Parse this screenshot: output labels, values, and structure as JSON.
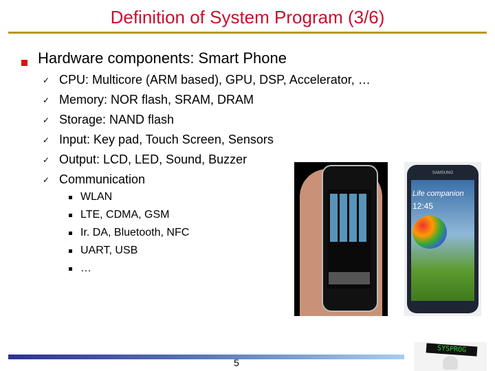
{
  "slide": {
    "title": "Definition of System Program (3/6)",
    "heading": "Hardware components: Smart Phone",
    "items": [
      "CPU: Multicore (ARM based), GPU, DSP, Accelerator, …",
      "Memory: NOR flash, SRAM, DRAM",
      "Storage: NAND flash",
      "Input: Key pad, Touch Screen, Sensors",
      "Output: LCD, LED, Sound, Buzzer",
      "Communication"
    ],
    "sub_items": [
      "WLAN",
      "LTE, CDMA, GSM",
      "Ir. DA, Bluetooth, NFC",
      "UART, USB",
      "…"
    ],
    "check_icon": "✓",
    "page_number": "5"
  },
  "images": {
    "samsung_brand": "SAMSUNG",
    "samsung_tagline": "Life companion",
    "samsung_time": "12:45",
    "logo_text": "SYSPROG"
  },
  "colors": {
    "title": "#c8102e",
    "rule": "#b8971c",
    "bullet": "#e01010"
  }
}
